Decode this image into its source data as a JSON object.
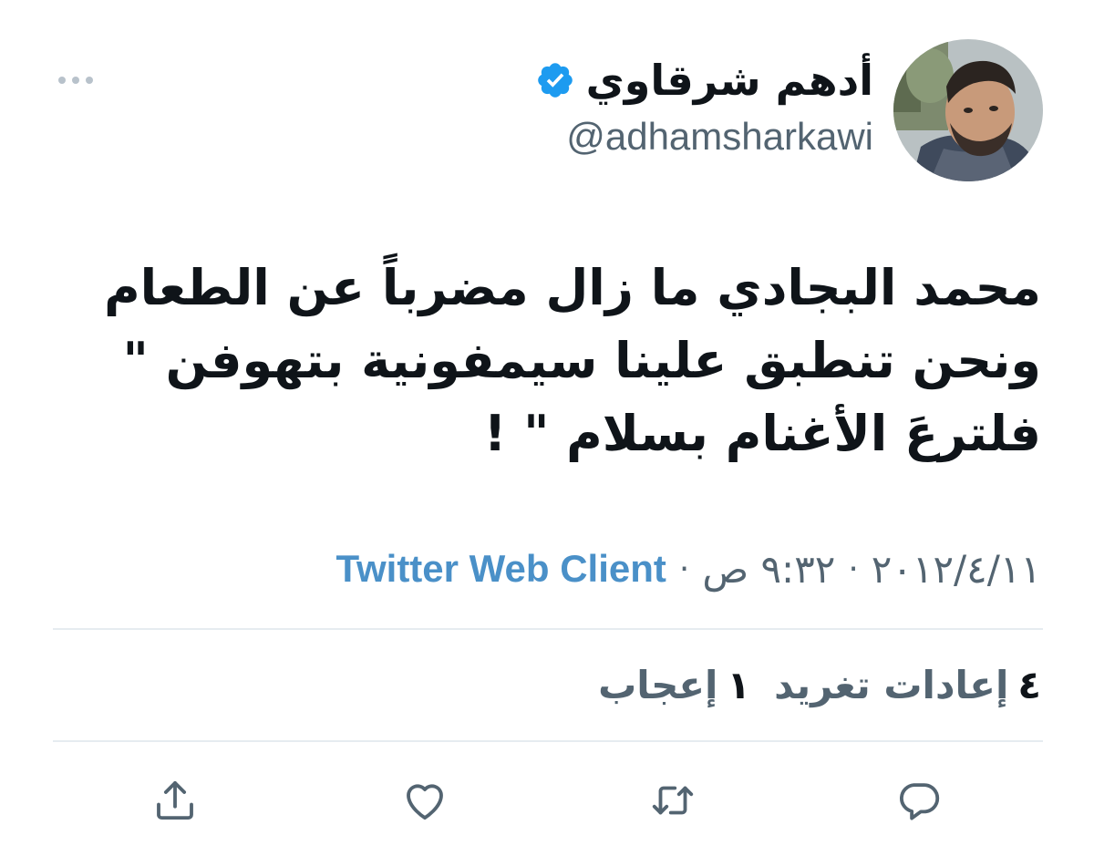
{
  "header": {
    "display_name": "أدهم شرقاوي",
    "handle": "@adhamsharkawi",
    "verified_icon": "verified-badge-icon",
    "more_icon": "more-options-icon"
  },
  "tweet": {
    "lines": [
      "محمد البجادي ما زال مضرباً عن الطعام",
      "ونحن تنطبق علينا سيمفونية بتهوفن \"",
      "فلترعَ الأغنام بسلام \" !"
    ]
  },
  "meta": {
    "date": "٢٠١٢/٤/١١",
    "separator": "·",
    "time": "٩:٣٢ ص",
    "source": "Twitter Web Client"
  },
  "stats": {
    "retweets_count": "٤",
    "retweets_label": "إعادات تغريد",
    "likes_count": "١",
    "likes_label": "إعجاب"
  },
  "actions": {
    "reply_icon": "reply-icon",
    "retweet_icon": "retweet-icon",
    "like_icon": "heart-icon",
    "share_icon": "share-icon"
  },
  "colors": {
    "text": "#0f1419",
    "secondary": "#536471",
    "accent": "#4a90c8",
    "verified": "#1d9bf0",
    "divider": "#e6ecf0"
  }
}
